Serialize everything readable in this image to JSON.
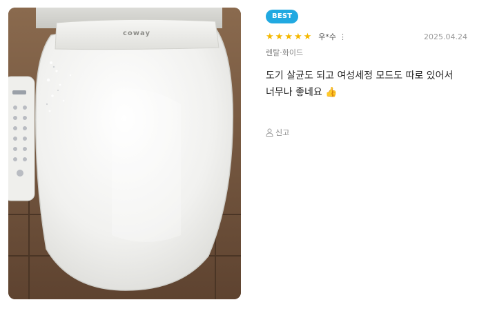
{
  "review": {
    "badge": "BEST",
    "stars": [
      "★",
      "★",
      "★",
      "★",
      "★"
    ],
    "author": "우*수",
    "more_icon": "⋮",
    "date": "2025.04.24",
    "option": "렌탈·화이드",
    "body_lines": [
      "도기 살균도 되고 여성세정 모드도 따로 있어서",
      "너무나 좋네요 👍"
    ],
    "report_label": "신고"
  },
  "photo": {
    "brand_text": "coway"
  }
}
